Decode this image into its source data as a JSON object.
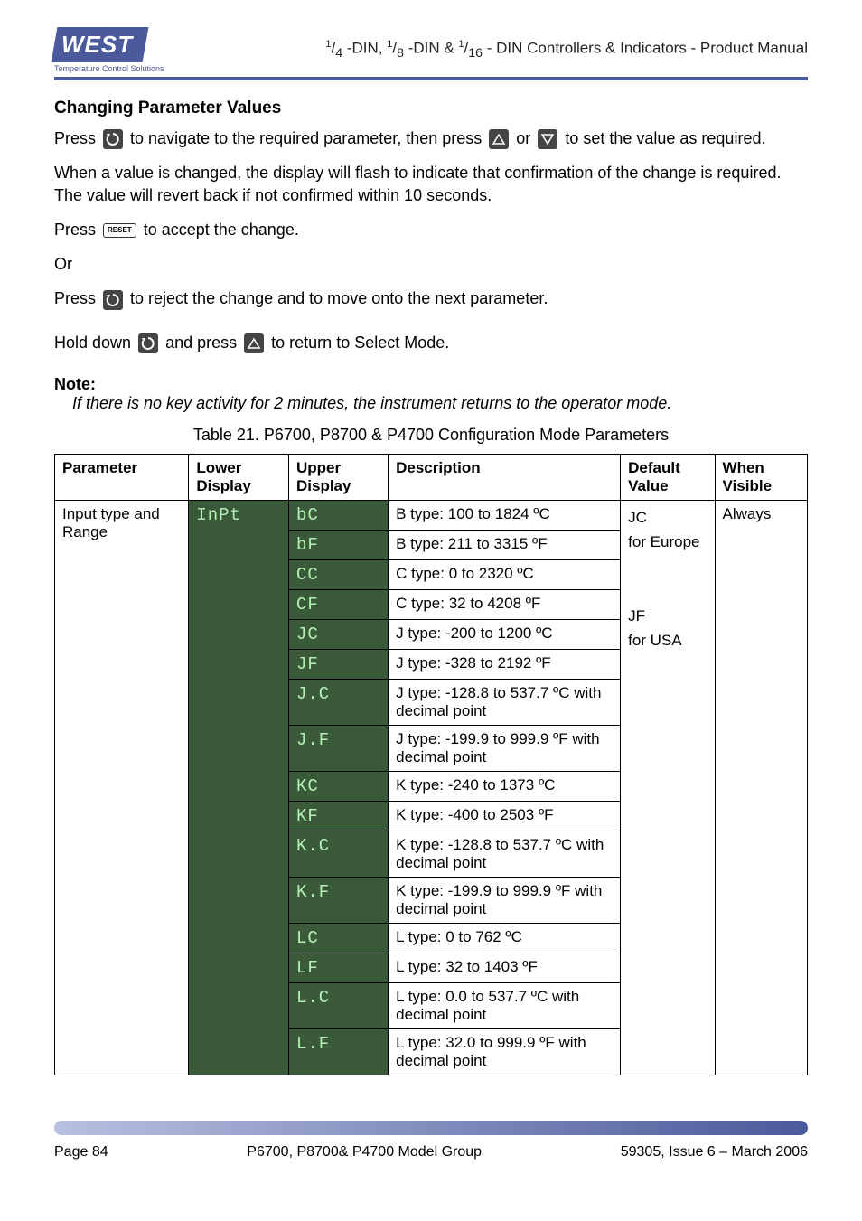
{
  "header": {
    "logo_main": "WEST",
    "logo_sub": "Temperature Control Solutions",
    "title_html": "¹/₄ -DIN, ¹/₈ -DIN & ¹/₁₆ - DIN Controllers & Indicators - Product Manual"
  },
  "section_title": "Changing Parameter Values",
  "press_nav_1": "Press ",
  "press_nav_2": " to navigate to the required parameter, then press ",
  "press_nav_3": " or ",
  "press_nav_4": " to set the value as required.",
  "value_changed": "When a value is changed, the display will flash to indicate that confirmation of the change is required. The value will revert back if not confirmed within 10 seconds.",
  "press_accept_1": "Press ",
  "press_accept_2": " to accept the change.",
  "or_text": "Or",
  "press_reject_1": "Press ",
  "press_reject_2": " to reject the change and to move onto the next parameter.",
  "hold_down_1": "Hold down ",
  "hold_down_2": " and press ",
  "hold_down_3": " to return to Select Mode.",
  "note_head": "Note:",
  "note_body": "If there is no key activity for 2 minutes, the instrument returns to the operator mode.",
  "table_caption": "Table 21.  P6700, P8700 & P4700 Configuration Mode Parameters",
  "table": {
    "headers": [
      "Parameter",
      "Lower Display",
      "Upper Display",
      "Description",
      "Default Value",
      "When Visible"
    ],
    "param_name": "Input type and Range",
    "lower_display": "InPt",
    "default_value_lines": [
      "JC",
      "for Europe",
      "",
      "JF",
      "for USA"
    ],
    "when_visible": "Always",
    "rows": [
      {
        "upper": "bC",
        "desc": "B type: 100 to 1824 ºC"
      },
      {
        "upper": "bF",
        "desc": "B type: 211 to 3315 ºF"
      },
      {
        "upper": "CC",
        "desc": "C type: 0 to 2320 ºC"
      },
      {
        "upper": "CF",
        "desc": "C type: 32 to 4208 ºF"
      },
      {
        "upper": "JC",
        "desc": "J type:  -200 to 1200 ºC"
      },
      {
        "upper": "JF",
        "desc": "J type:  -328 to 2192 ºF"
      },
      {
        "upper": "J.C",
        "desc": "J type:  -128.8 to 537.7 ºC with decimal point"
      },
      {
        "upper": "J.F",
        "desc": "J type:  -199.9 to 999.9 ºF with decimal point"
      },
      {
        "upper": "KC",
        "desc": "K type: -240 to 1373 ºC"
      },
      {
        "upper": "KF",
        "desc": "K type:  -400 to 2503 ºF"
      },
      {
        "upper": "K.C",
        "desc": "K type: -128.8 to 537.7 ºC with decimal point"
      },
      {
        "upper": "K.F",
        "desc": "K type: -199.9 to 999.9 ºF with decimal point"
      },
      {
        "upper": "LC",
        "desc": "L type: 0 to 762 ºC"
      },
      {
        "upper": "LF",
        "desc": "L type: 32 to 1403 ºF"
      },
      {
        "upper": "L.C",
        "desc": "L type: 0.0 to 537.7 ºC with decimal point"
      },
      {
        "upper": "L.F",
        "desc": "L type: 32.0 to 999.9 ºF with decimal point"
      }
    ]
  },
  "footer": {
    "left": "Page 84",
    "center": "P6700, P8700& P4700 Model Group",
    "right": "59305, Issue 6 – March 2006"
  },
  "icons": {
    "cycle": "cycle-icon",
    "up": "up-triangle-icon",
    "down": "down-triangle-icon",
    "reset_label": "RESET"
  }
}
